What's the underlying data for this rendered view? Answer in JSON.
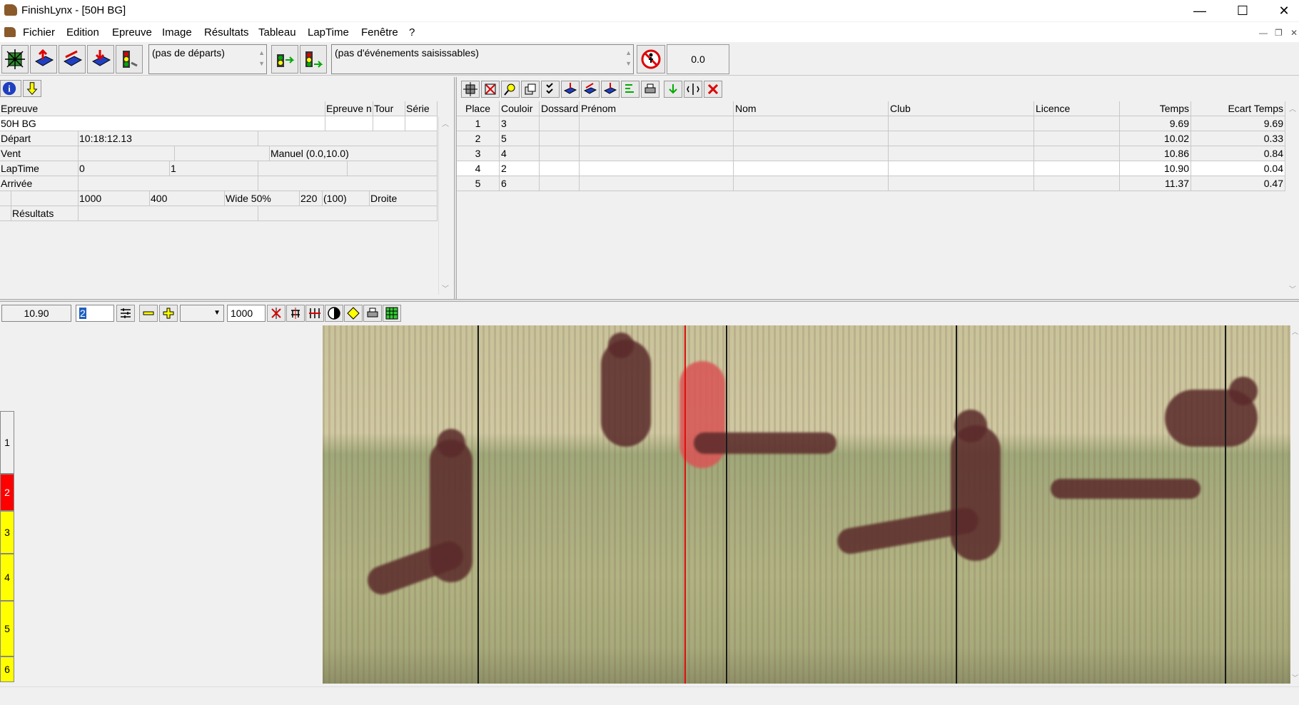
{
  "window": {
    "title": "FinishLynx - [50H BG]",
    "minimize": "—",
    "maximize": "☐",
    "close": "✕"
  },
  "menu": [
    "Fichier",
    "Edition",
    "Epreuve",
    "Image",
    "Résultats",
    "Tableau",
    "LapTime",
    "Fenêtre",
    "?"
  ],
  "toolbar": {
    "start_combo": "(pas de départs)",
    "event_combo": "(pas d'événements saisissables)",
    "timer_value": "0.0"
  },
  "event_info": {
    "headers": {
      "epreuve": "Epreuve",
      "epreuve_n": "Epreuve n",
      "tour": "Tour",
      "serie": "Série"
    },
    "event_name": "50H BG",
    "rows": {
      "depart_label": "Départ",
      "depart_value": "10:18:12.13",
      "vent_label": "Vent",
      "vent_value": "Manuel (0.0,10.0)",
      "laptime_label": "LapTime",
      "laptime_v1": "0",
      "laptime_v2": "1",
      "arrivee_label": "Arrivée",
      "settings": [
        "1000",
        "400",
        "Wide 50%",
        "220",
        "(100)",
        "Droite"
      ],
      "resultats_label": "Résultats"
    }
  },
  "results": {
    "columns": [
      "Place",
      "Couloir",
      "Dossard",
      "Prénom",
      "Nom",
      "Club",
      "Licence",
      "Temps",
      "Ecart Temps"
    ],
    "rows": [
      {
        "place": "1",
        "couloir": "3",
        "temps": "9.69",
        "ecart": "9.69"
      },
      {
        "place": "2",
        "couloir": "5",
        "temps": "10.02",
        "ecart": "0.33"
      },
      {
        "place": "3",
        "couloir": "4",
        "temps": "10.86",
        "ecart": "0.84"
      },
      {
        "place": "4",
        "couloir": "2",
        "temps": "10.90",
        "ecart": "0.04"
      },
      {
        "place": "5",
        "couloir": "6",
        "temps": "11.37",
        "ecart": "0.47"
      }
    ]
  },
  "image_toolbar": {
    "time_value": "10.90",
    "lane_value": "2",
    "density_value": "1000"
  },
  "lanes": [
    {
      "label": "1",
      "color": "#f0f0f0"
    },
    {
      "label": "2",
      "color": "#ff0000"
    },
    {
      "label": "3",
      "color": "#ffff00"
    },
    {
      "label": "4",
      "color": "#ffff00"
    },
    {
      "label": "5",
      "color": "#ffff00"
    },
    {
      "label": "6",
      "color": "#ffff00"
    }
  ]
}
